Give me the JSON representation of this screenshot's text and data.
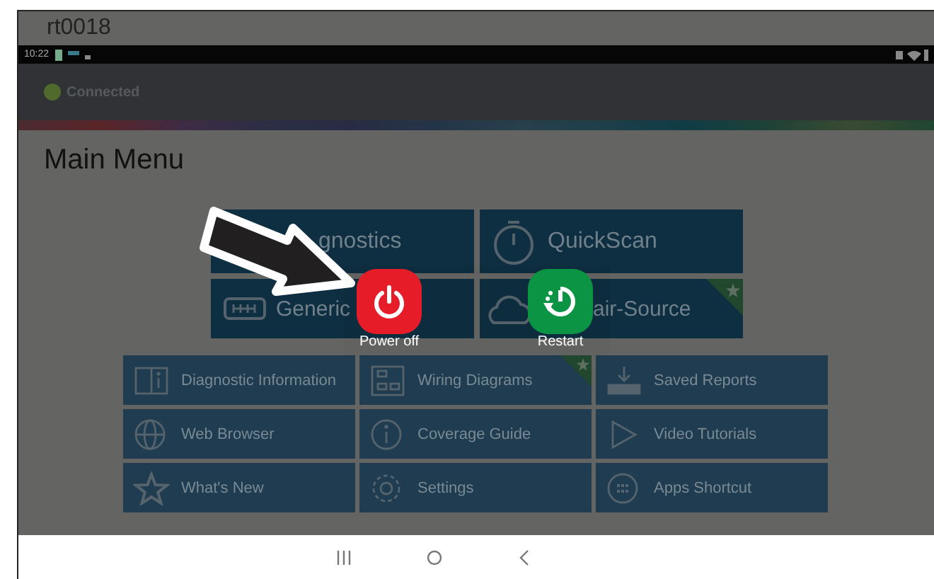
{
  "window": {
    "title": "rt0018"
  },
  "status_bar": {
    "time": "10:22"
  },
  "header": {
    "connection": "Connected",
    "color": "#4f6a2c"
  },
  "page_title": "Main Menu",
  "main_tiles": [
    {
      "label": "gnostics",
      "starred": false
    },
    {
      "label": "QuickScan",
      "starred": false
    },
    {
      "label": "Generic",
      "starred": false
    },
    {
      "label": "air-Source",
      "starred": true
    }
  ],
  "tools": [
    {
      "label": "Diagnostic Information",
      "starred": false
    },
    {
      "label": "Wiring Diagrams",
      "starred": true
    },
    {
      "label": "Saved Reports",
      "starred": false
    },
    {
      "label": "Web Browser",
      "starred": false
    },
    {
      "label": "Coverage Guide",
      "starred": false
    },
    {
      "label": "Video Tutorials",
      "starred": false
    },
    {
      "label": "What's New",
      "starred": false
    },
    {
      "label": "Settings",
      "starred": false
    },
    {
      "label": "Apps Shortcut",
      "starred": false
    }
  ],
  "power_menu": [
    {
      "label": "Power off",
      "kind": "power"
    },
    {
      "label": "Restart",
      "kind": "restart"
    }
  ]
}
